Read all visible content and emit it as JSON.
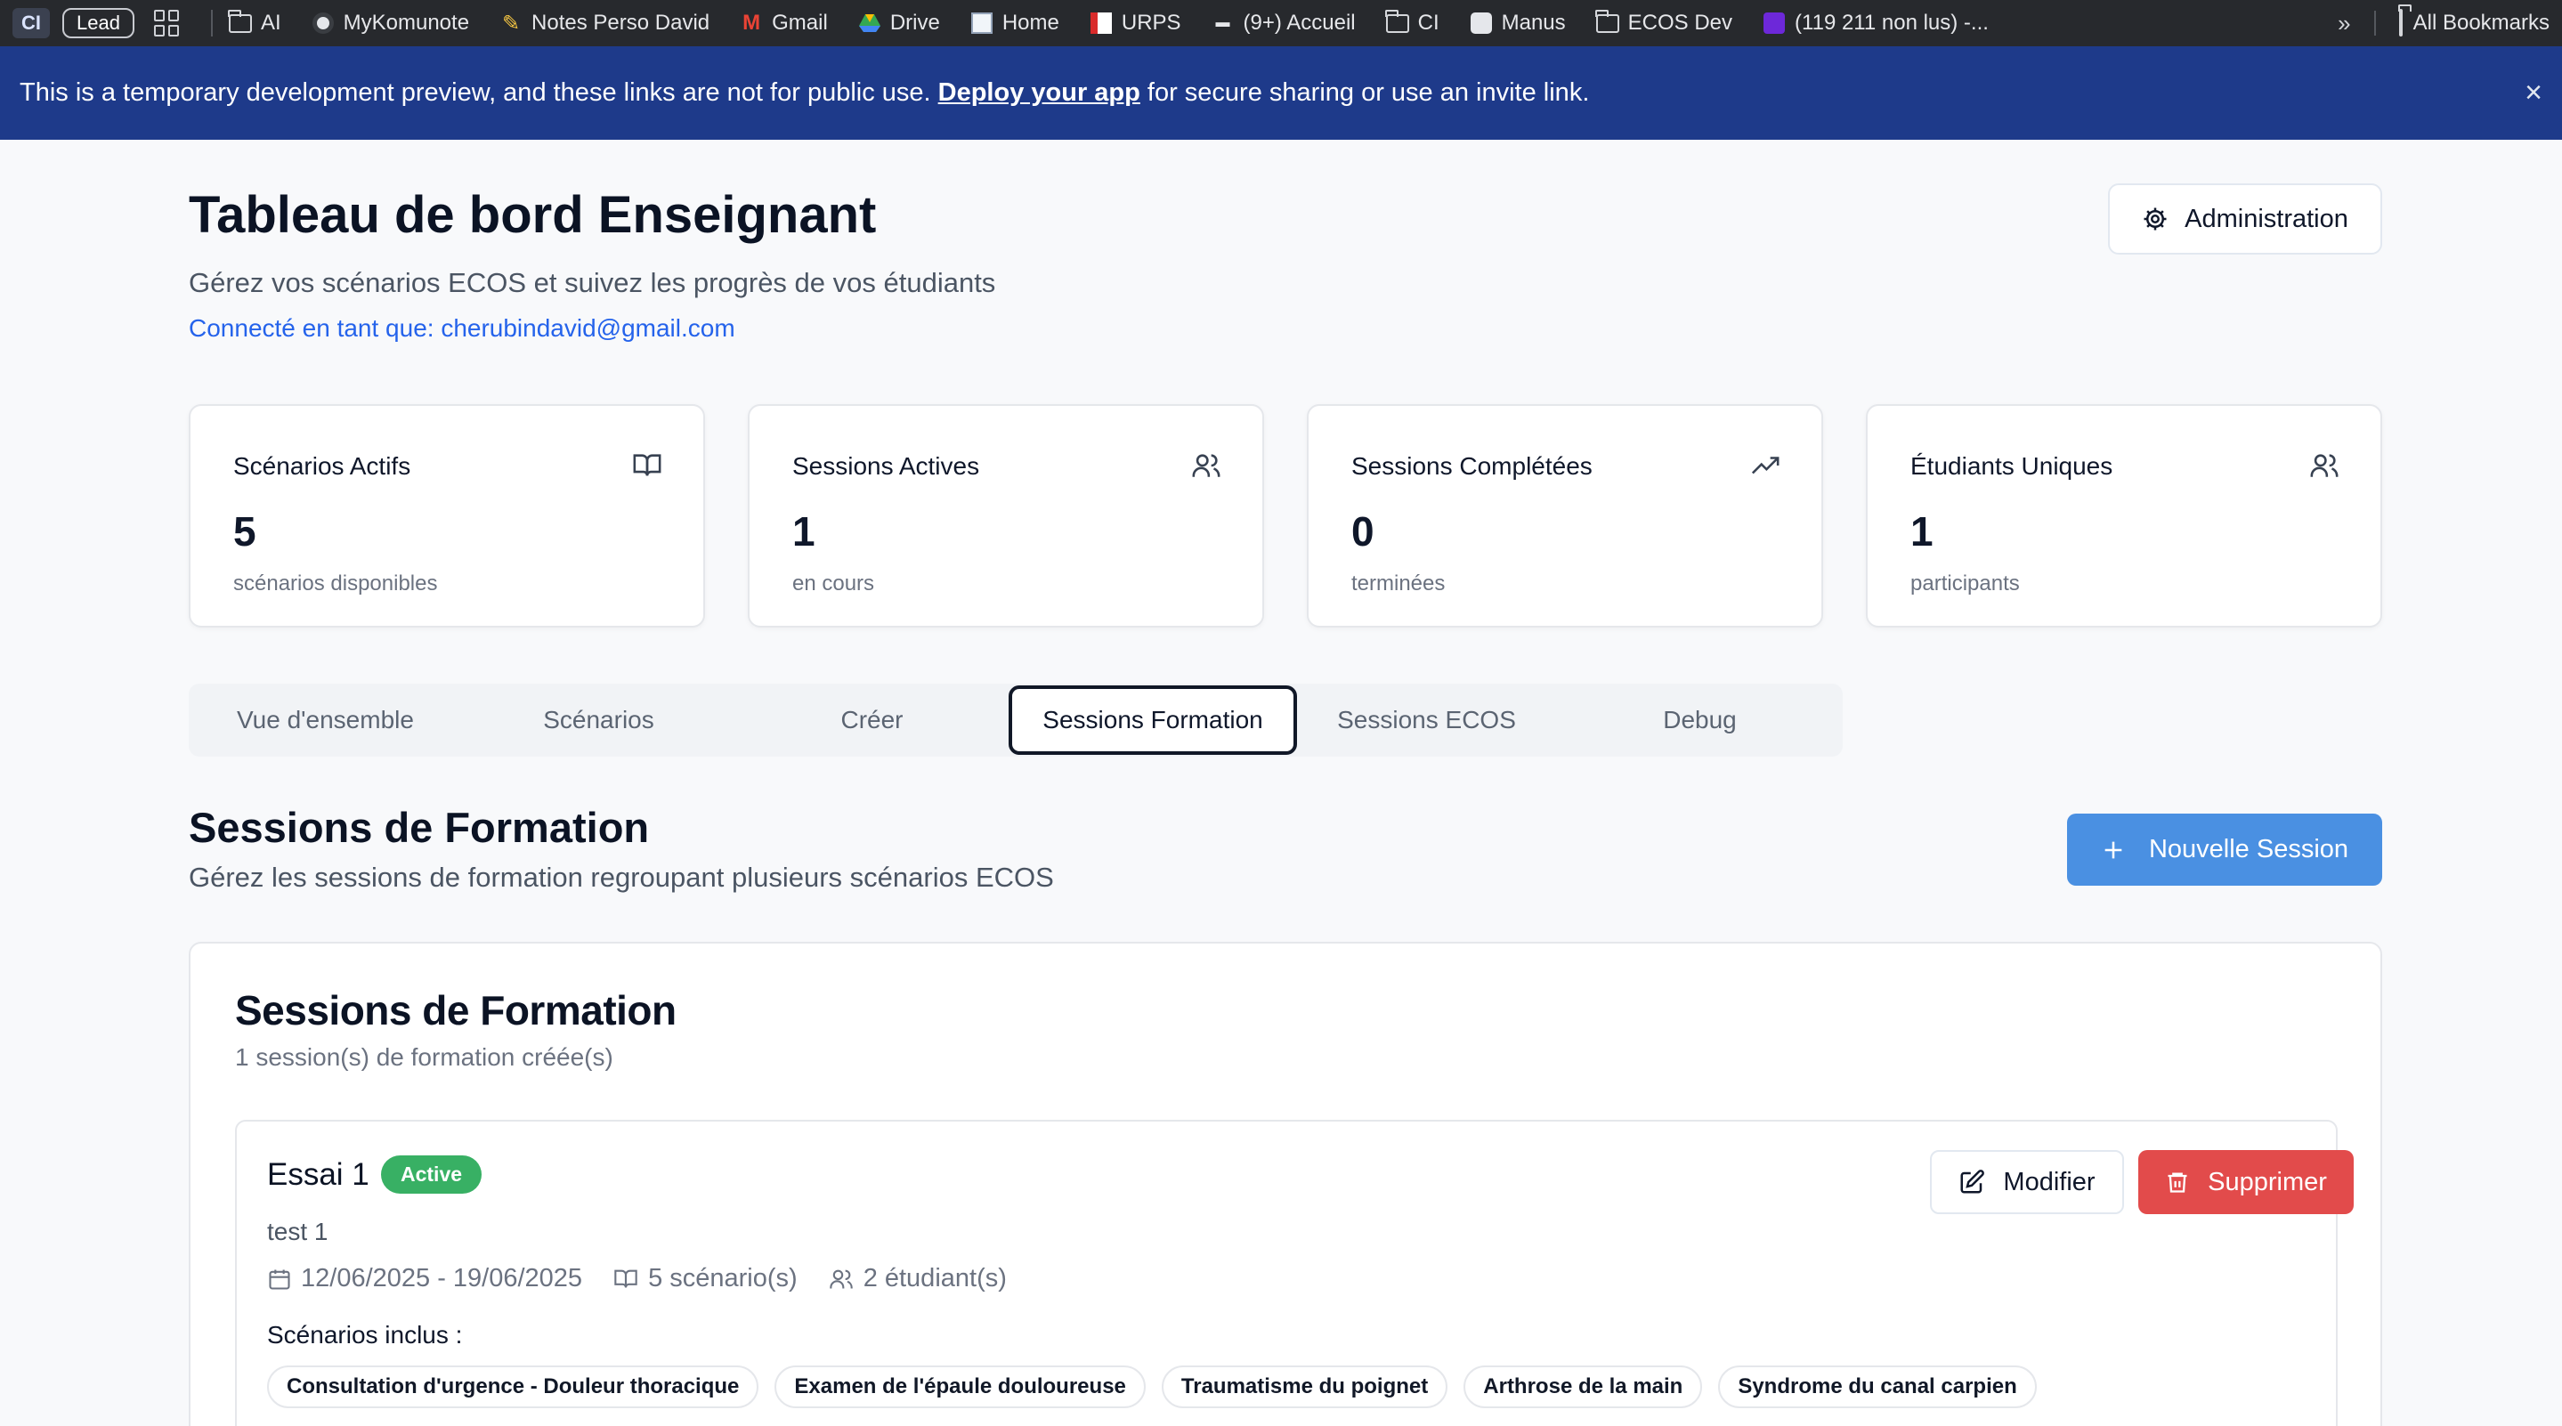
{
  "bookmarks": {
    "ci": "CI",
    "lead": "Lead",
    "items": [
      "AI",
      "MyKomunote",
      "Notes Perso David",
      "Gmail",
      "Drive",
      "Home",
      "URPS",
      "(9+) Accueil",
      "CI",
      "Manus",
      "ECOS Dev",
      "(119 211 non lus) -..."
    ],
    "more": "»",
    "all": "All Bookmarks"
  },
  "banner": {
    "text_before": "This is a temporary development preview, and these links are not for public use. ",
    "link": "Deploy your app",
    "text_after": " for secure sharing or use an invite link.",
    "close": "×"
  },
  "header": {
    "title": "Tableau de bord Enseignant",
    "subtitle": "Gérez vos scénarios ECOS et suivez les progrès de vos étudiants",
    "connected": "Connecté en tant que: cherubindavid@gmail.com",
    "admin_label": "Administration"
  },
  "stats": [
    {
      "label": "Scénarios Actifs",
      "value": "5",
      "desc": "scénarios disponibles",
      "icon": "book-icon"
    },
    {
      "label": "Sessions Actives",
      "value": "1",
      "desc": "en cours",
      "icon": "users-icon"
    },
    {
      "label": "Sessions Complétées",
      "value": "0",
      "desc": "terminées",
      "icon": "trending-up-icon"
    },
    {
      "label": "Étudiants Uniques",
      "value": "1",
      "desc": "participants",
      "icon": "users-icon"
    }
  ],
  "tabs": [
    "Vue d'ensemble",
    "Scénarios",
    "Créer",
    "Sessions Formation",
    "Sessions ECOS",
    "Debug"
  ],
  "active_tab": "Sessions Formation",
  "section": {
    "title": "Sessions de Formation",
    "subtitle": "Gérez les sessions de formation regroupant plusieurs scénarios ECOS",
    "new_button": "Nouvelle Session"
  },
  "panel": {
    "title": "Sessions de Formation",
    "subtitle": "1 session(s) de formation créée(s)",
    "sessions": [
      {
        "name": "Essai 1",
        "status": "Active",
        "description": "test 1",
        "dates": "12/06/2025 - 19/06/2025",
        "scenarios_count": "5 scénario(s)",
        "students_count": "2 étudiant(s)",
        "included_label": "Scénarios inclus :",
        "scenarios": [
          "Consultation d'urgence - Douleur thoracique",
          "Examen de l'épaule douloureuse",
          "Traumatisme du poignet",
          "Arthrose de la main",
          "Syndrome du canal carpien"
        ],
        "edit_label": "Modifier",
        "delete_label": "Supprimer"
      }
    ]
  },
  "colors": {
    "banner": "#1e3a8a",
    "primary": "#4a90e2",
    "danger": "#e24b4b",
    "active_badge": "#16a34a",
    "link": "#2563eb"
  }
}
